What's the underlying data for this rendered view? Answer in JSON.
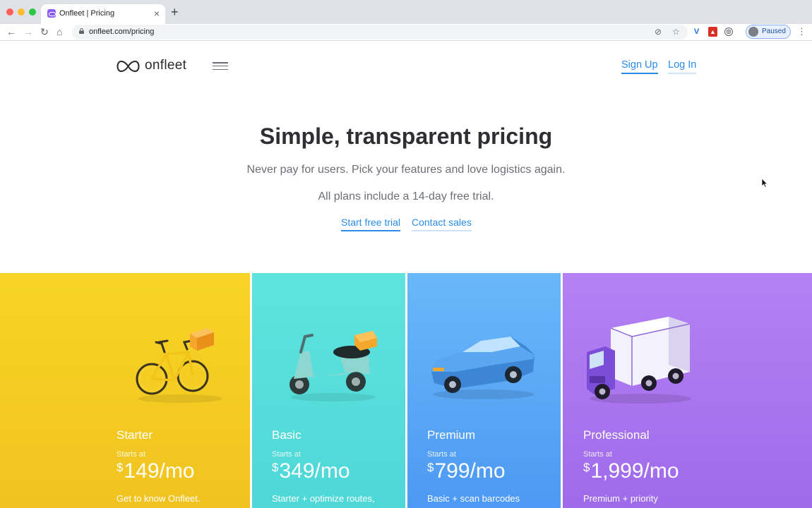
{
  "browser": {
    "tab_title": "Onfleet | Pricing",
    "url": "onfleet.com/pricing",
    "profile_label": "Paused"
  },
  "header": {
    "logo_text": "onfleet",
    "signup_label": "Sign Up",
    "login_label": "Log In"
  },
  "hero": {
    "title": "Simple, transparent pricing",
    "subtitle": "Never pay for users. Pick your features and love logistics again.",
    "trial_note": "All plans include a 14-day free trial.",
    "start_trial_label": "Start free trial",
    "contact_sales_label": "Contact sales"
  },
  "plans": [
    {
      "name": "Starter",
      "starts_at": "Starts at",
      "currency": "$",
      "price": "149/mo",
      "description": "Get to know Onfleet.",
      "color": "#f5d024",
      "vehicle": "bicycle"
    },
    {
      "name": "Basic",
      "starts_at": "Starts at",
      "currency": "$",
      "price": "349/mo",
      "description": "Starter + optimize routes,",
      "color": "#58dfdb",
      "vehicle": "scooter"
    },
    {
      "name": "Premium",
      "starts_at": "Starts at",
      "currency": "$",
      "price": "799/mo",
      "description": "Basic + scan barcodes",
      "color": "#5aa8f6",
      "vehicle": "car"
    },
    {
      "name": "Professional",
      "starts_at": "Starts at",
      "currency": "$",
      "price": "1,999/mo",
      "description": "Premium + priority",
      "color": "#ab76ef",
      "vehicle": "truck"
    }
  ]
}
